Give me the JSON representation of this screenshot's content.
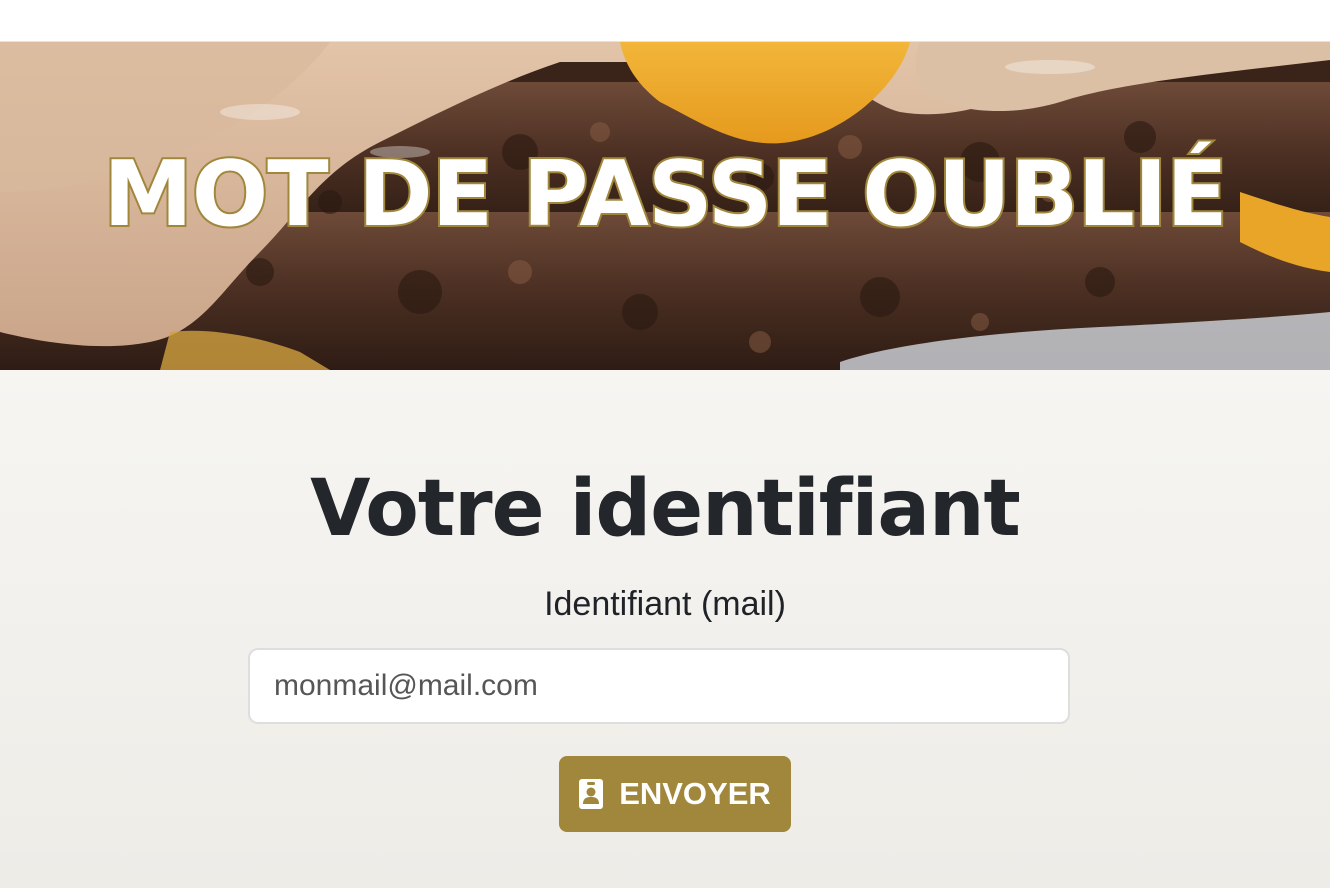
{
  "hero": {
    "title": "MOT DE PASSE OUBLIÉ"
  },
  "form": {
    "heading": "Votre identifiant",
    "label": "Identifiant (mail)",
    "email_placeholder": "monmail@mail.com",
    "email_value": "",
    "submit_label": "ENVOYER",
    "submit_icon": "id-badge-icon"
  },
  "colors": {
    "accent": "#a0873b",
    "heading": "#23262b",
    "background": "#f3f1ee"
  }
}
